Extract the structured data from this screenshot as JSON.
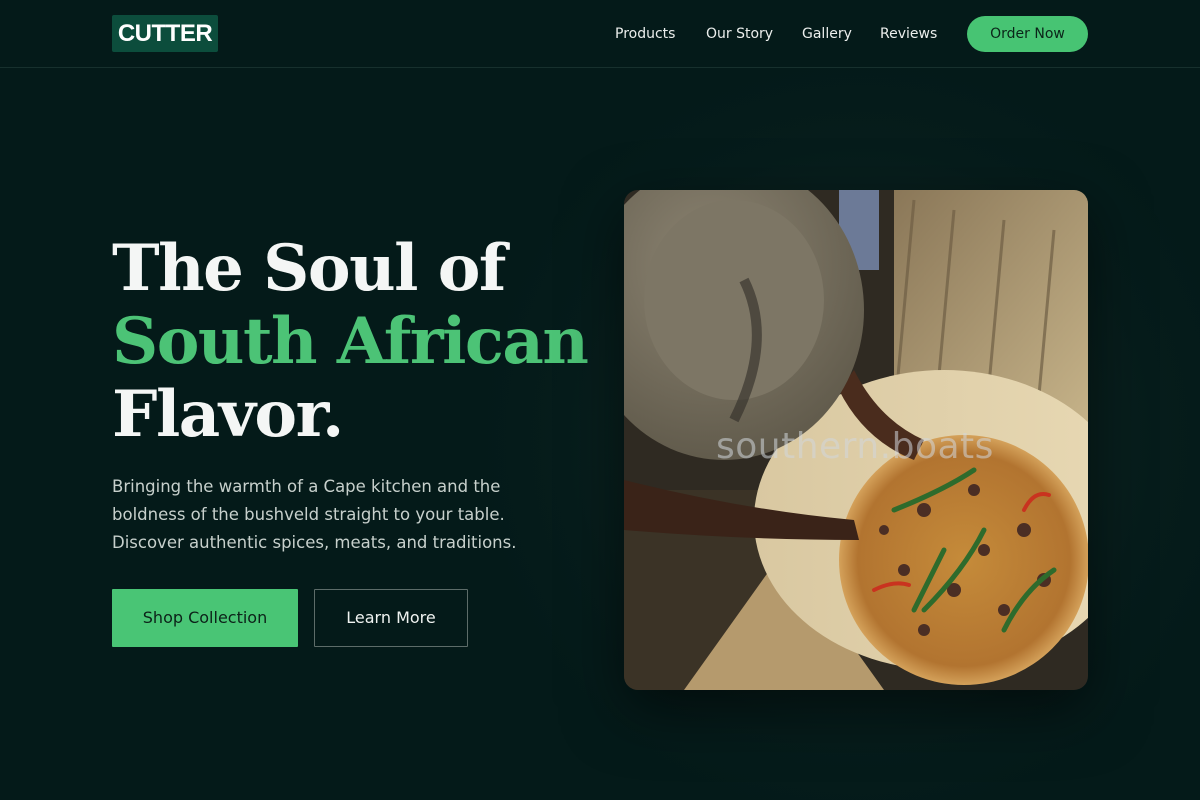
{
  "nav": {
    "logo": "CUTTER",
    "links": [
      "Products",
      "Our Story",
      "Gallery",
      "Reviews"
    ],
    "cta": "Order Now"
  },
  "hero": {
    "title_line1": "The Soul of",
    "title_line2": "South African",
    "title_line3": "Flavor.",
    "description": "Bringing the warmth of a Cape kitchen and the boldness of the bushveld straight to your table. Discover authentic spices, meats, and traditions.",
    "primary_button": "Shop Collection",
    "secondary_button": "Learn More",
    "image_watermark": "southern.boats"
  },
  "colors": {
    "background": "#041a19",
    "accent": "#4cc376",
    "logo_bg": "#0c4d3c"
  }
}
